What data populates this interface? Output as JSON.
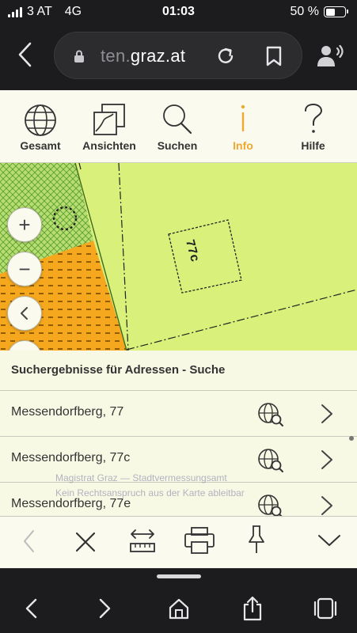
{
  "status": {
    "carrier": "3 AT",
    "network": "4G",
    "time": "01:03",
    "battery_percent": "50 %",
    "battery_level": 0.5
  },
  "browser": {
    "url_faded": "ten.",
    "url_main": "graz.at"
  },
  "toolbar": {
    "items": [
      {
        "label": "Gesamt",
        "icon": "globe-icon"
      },
      {
        "label": "Ansichten",
        "icon": "layers-icon"
      },
      {
        "label": "Suchen",
        "icon": "search-icon"
      },
      {
        "label": "Info",
        "icon": "info-icon"
      },
      {
        "label": "Hilfe",
        "icon": "help-icon"
      }
    ],
    "active": "Info",
    "active_color": "#f0a830"
  },
  "map": {
    "parcel_label": "77c",
    "zoom_in": "+",
    "zoom_out": "−",
    "colors": {
      "lawn": "#d9f07a",
      "orange_zone": "#f5a81d",
      "green_hatch": "#8cc84b"
    }
  },
  "results": {
    "title": "Suchergebnisse für Adressen - Suche",
    "rows": [
      {
        "label": "Messendorfberg, 77"
      },
      {
        "label": "Messendorfberg, 77c"
      },
      {
        "label": "Messendorfberg, 77e"
      }
    ],
    "watermark_line1": "Magistrat Graz — Stadtvermessungsamt",
    "watermark_line2": "Kein Rechtsanspruch aus der Karte ableitbar"
  },
  "actions": {
    "items": [
      "back-icon",
      "close-icon",
      "measure-icon",
      "print-icon",
      "pin-icon",
      "collapse-icon"
    ]
  }
}
